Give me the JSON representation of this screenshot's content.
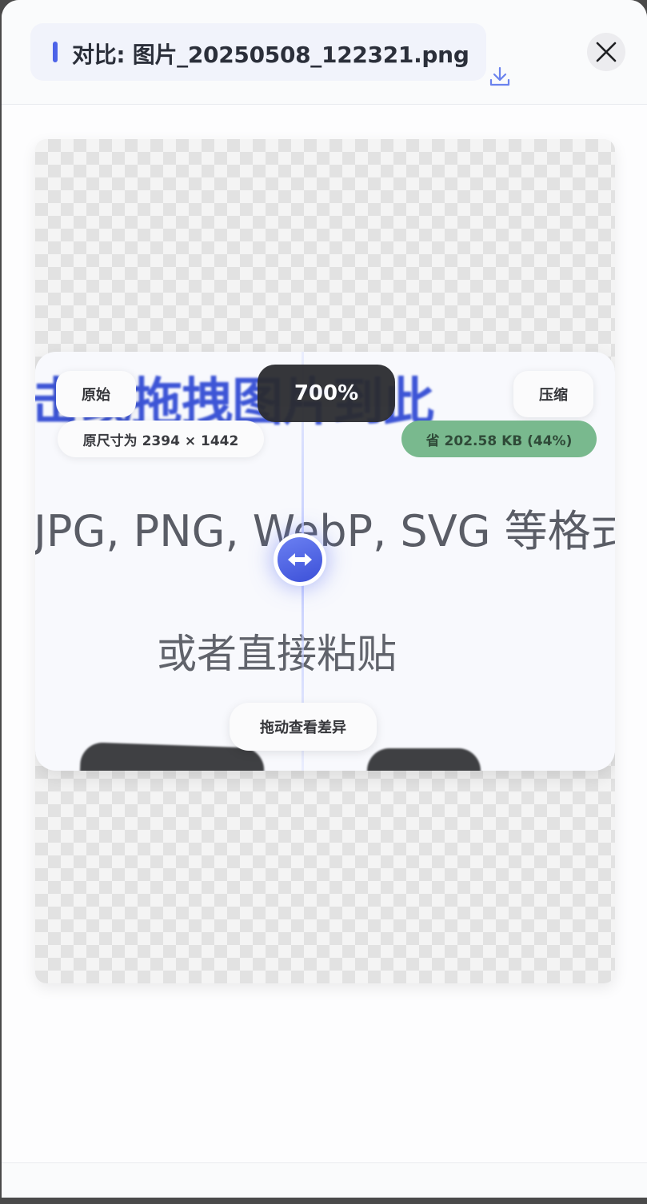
{
  "header": {
    "title": "对比: 图片_20250508_122321.png"
  },
  "icons": {
    "download": "download-icon",
    "close": "close-icon",
    "handle": "arrows-horizontal-icon"
  },
  "viewer": {
    "original_label": "原始",
    "compressed_label": "压缩",
    "zoom": "700%",
    "original_size": "原尺寸为 2394 × 1442",
    "saved": "省 202.58 KB (44%)",
    "drag_hint": "拖动查看差异",
    "image_text": {
      "line1": "击或拖拽图片到此",
      "line2": "JPG, PNG, WebP, SVG 等格式",
      "line3": "或者直接粘贴"
    }
  },
  "colors": {
    "accent": "#4d63e8",
    "saved_badge": "#79b98e",
    "zoom_badge": "#2b2c30"
  }
}
